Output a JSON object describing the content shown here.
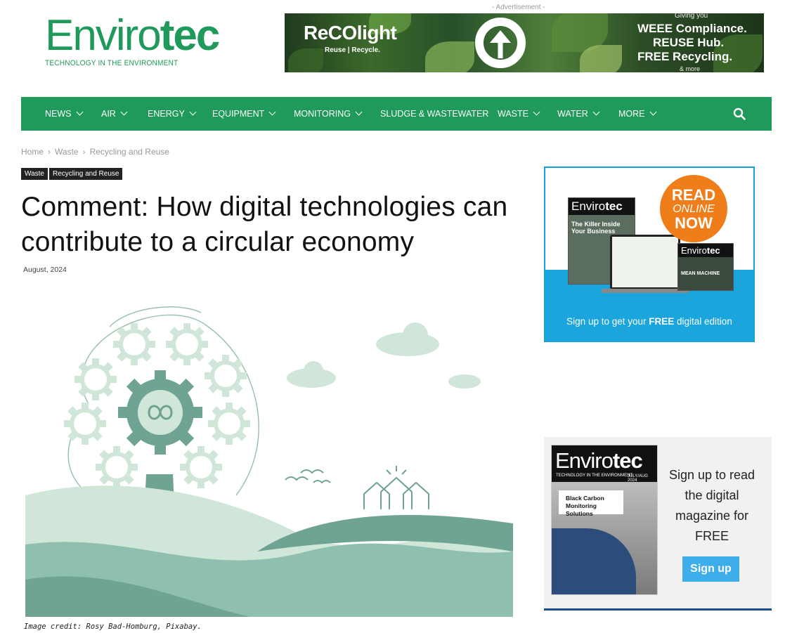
{
  "header": {
    "logo_light": "Enviro",
    "logo_bold": "tec",
    "logo_tagline": "TECHNOLOGY IN THE ENVIRONMENT",
    "brand_color": "#1f9a5a"
  },
  "advert": {
    "label": "- Advertisement -",
    "brand": "ReCOlight",
    "brand_sub": "Reuse | Recycle.",
    "giving": "Giving you",
    "lines": [
      "WEEE Compliance.",
      "REUSE Hub.",
      "FREE Recycling."
    ],
    "more": "& more"
  },
  "nav": {
    "items": [
      {
        "label": "NEWS",
        "dropdown": true
      },
      {
        "label": "AIR",
        "dropdown": true
      },
      {
        "label": "ENERGY",
        "dropdown": true
      },
      {
        "label": "EQUIPMENT",
        "dropdown": true
      },
      {
        "label": "MONITORING",
        "dropdown": true
      },
      {
        "label": "SLUDGE & WASTEWATER",
        "dropdown": false
      },
      {
        "label": "WASTE",
        "dropdown": true
      },
      {
        "label": "WATER",
        "dropdown": true
      },
      {
        "label": "MORE",
        "dropdown": true
      }
    ],
    "search_icon": "search-icon"
  },
  "breadcrumb": [
    "Home",
    "Waste",
    "Recycling and Reuse"
  ],
  "tags": [
    "Waste",
    "Recycling and Reuse"
  ],
  "article": {
    "title": "Comment: How digital technologies can contribute to a circular economy",
    "date": "August, 2024",
    "image_caption": "Image credit: Rosy Bad-Homburg, Pixabay."
  },
  "sidebar_promo": {
    "badge_read": "READ",
    "badge_online": "ONLINE",
    "badge_now": "NOW",
    "cover_logo_light": "Enviro",
    "cover_logo_bold": "tec",
    "cover_headline": "The Killer Inside Your Business",
    "cover2_headline": "MEAN MACHINE",
    "cta_prefix": "Sign up to get your ",
    "cta_bold": "FREE",
    "cta_suffix": " digital edition"
  },
  "sidebar_magazine": {
    "cover_logo_light": "Enviro",
    "cover_logo_bold": "tec",
    "cover_tagline": "TECHNOLOGY IN THE ENVIRONMENT",
    "cover_issue": "JULY/AUG 2024",
    "cover_headline": "Black Carbon Monitoring Solutions",
    "text": "Sign up to read the digital magazine for FREE",
    "button": "Sign up"
  }
}
